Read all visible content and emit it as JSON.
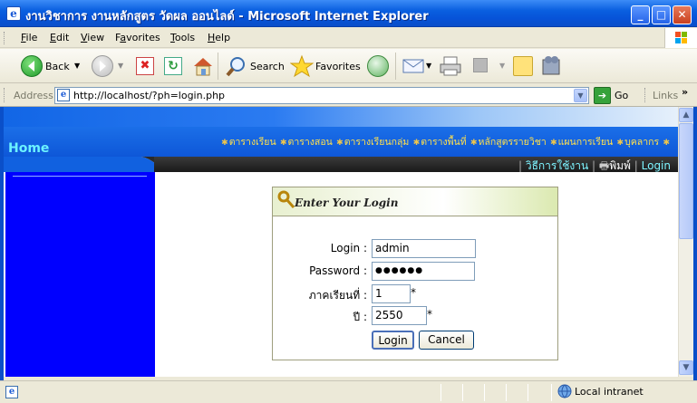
{
  "window": {
    "title": "งานวิชาการ งานหลักสูตร วัดผล ออนไลด์ - Microsoft Internet Explorer",
    "controls": {
      "minimize": "_",
      "maximize": "□",
      "close": "✕"
    }
  },
  "menu": {
    "items": [
      {
        "label": "File",
        "key": "F"
      },
      {
        "label": "Edit",
        "key": "E"
      },
      {
        "label": "View",
        "key": "V"
      },
      {
        "label": "Favorites",
        "key": "a"
      },
      {
        "label": "Tools",
        "key": "T"
      },
      {
        "label": "Help",
        "key": "H"
      }
    ]
  },
  "toolbar": {
    "back_label": "Back",
    "search_label": "Search",
    "favorites_label": "Favorites"
  },
  "address_bar": {
    "label": "Address",
    "url": "http://localhost/?ph=login.php",
    "go_label": "Go",
    "links_label": "Links"
  },
  "site": {
    "home_label": "Home",
    "nav_items": [
      "ตารางเรียน",
      "ตารางสอน",
      "ตารางเรียนกลุ่ม",
      "ตารางพื้นที่",
      "หลักสูตรรายวิชา",
      "แผนการเรียน",
      "บุคลากร"
    ],
    "help_label": "วิธีการใช้งาน",
    "print_label": "พิมพ์",
    "login_label": "Login"
  },
  "login_form": {
    "header": "Enter Your Login",
    "login_label": "Login :",
    "login_value": "admin",
    "password_label": "Password :",
    "password_value": "●●●●●●",
    "semester_label": "ภาคเรียนที่ :",
    "semester_value": "1",
    "year_label": "ปี :",
    "year_value": "2550",
    "required_mark": "*",
    "login_button": "Login",
    "cancel_button": "Cancel"
  },
  "status_bar": {
    "zone": "Local intranet"
  },
  "colors": {
    "sidebar": "#0000ff",
    "nav_text": "#ffe04d",
    "home_text": "#6cf3ff",
    "title_bar": "#0753d8"
  }
}
